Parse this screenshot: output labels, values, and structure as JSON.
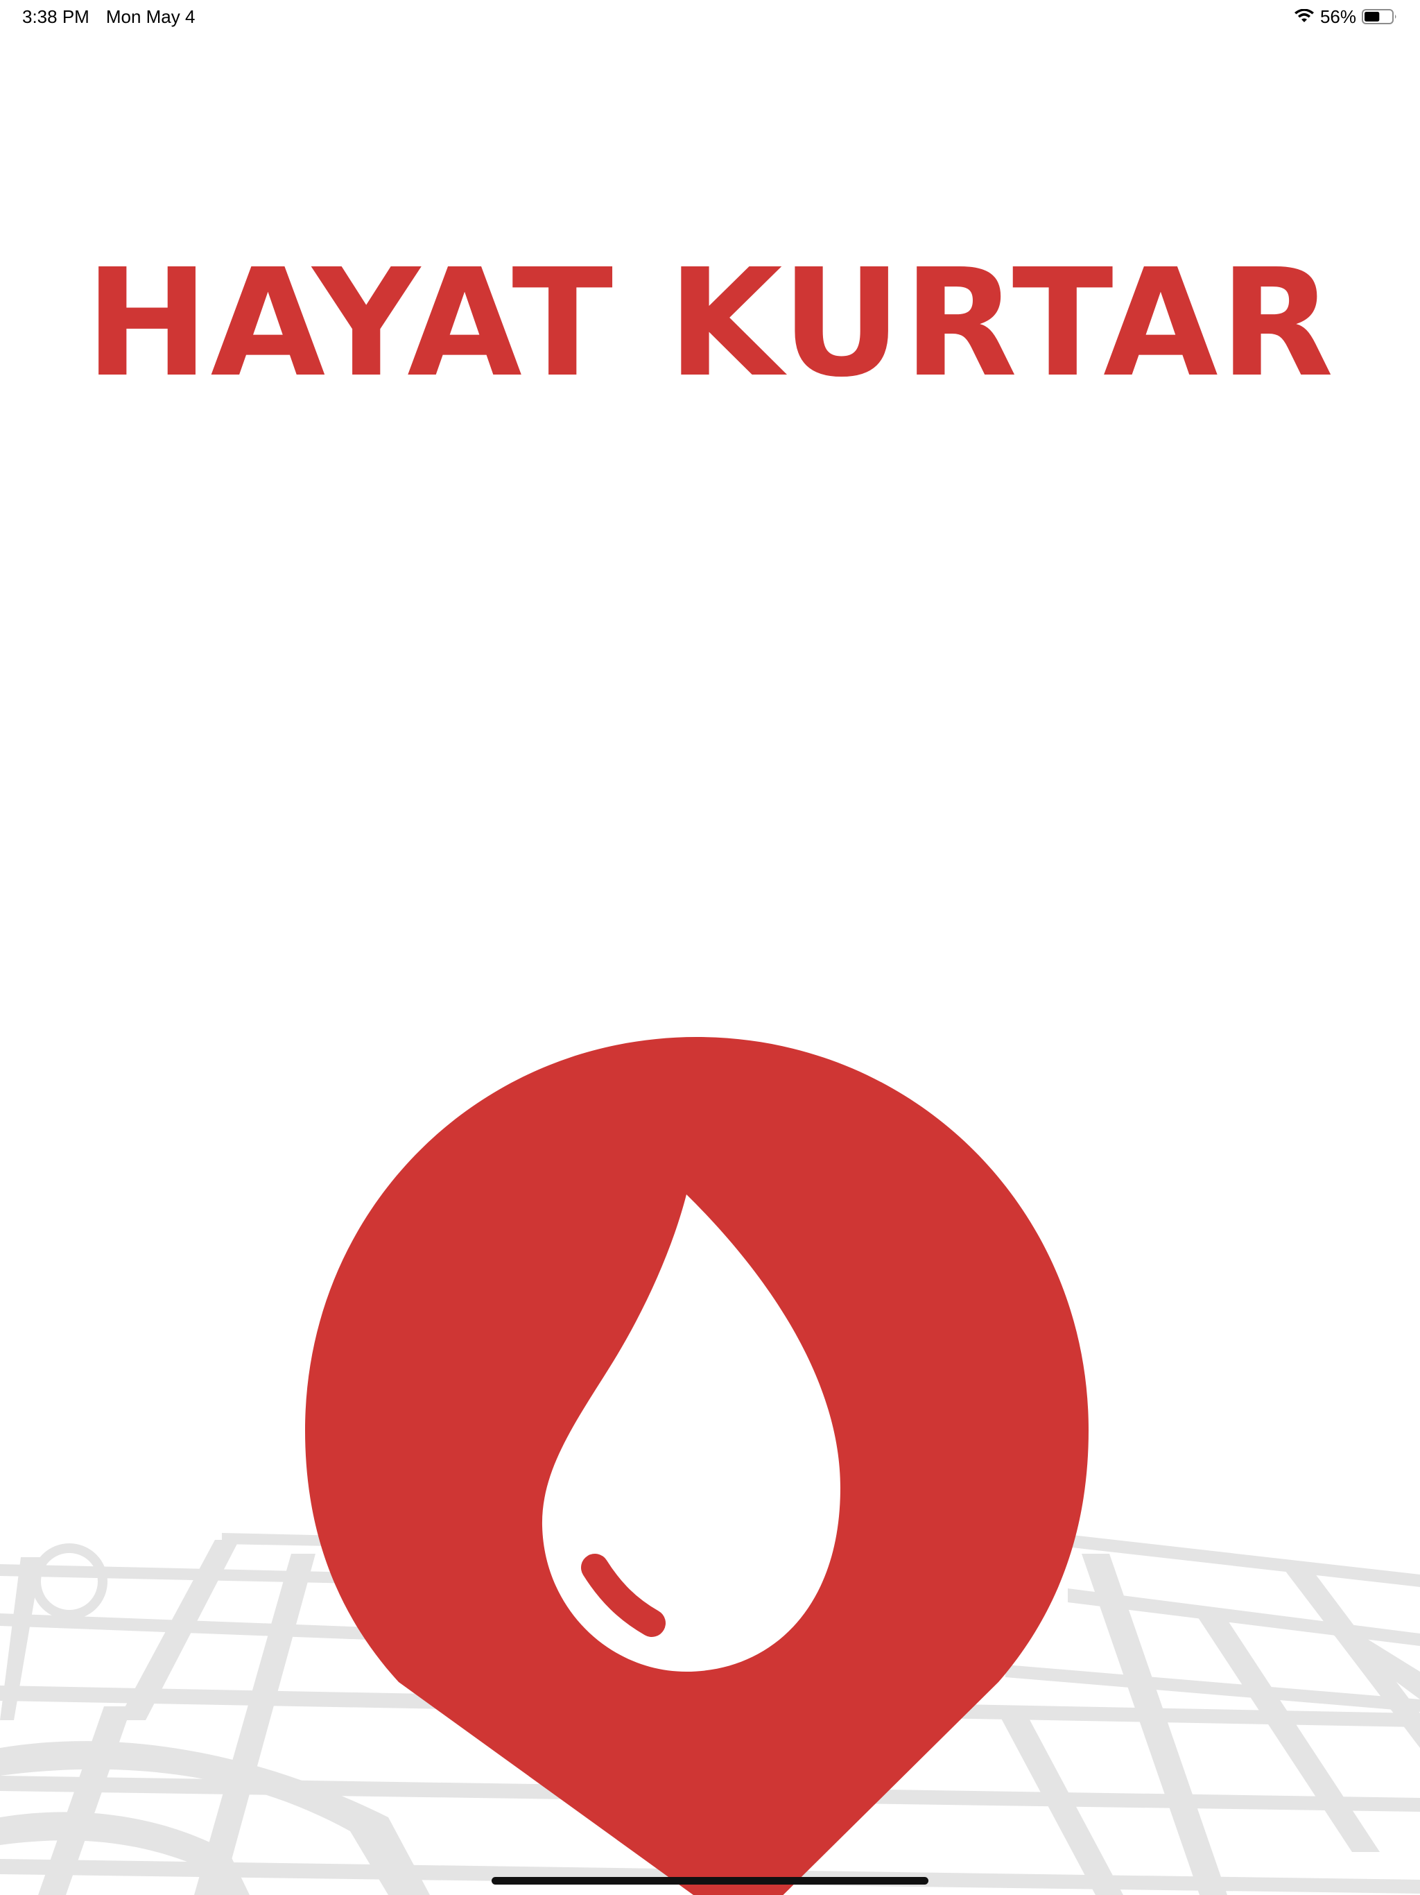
{
  "status_bar": {
    "time": "3:38 PM",
    "date": "Mon May 4",
    "battery_percent": "56%",
    "battery_level": 0.56
  },
  "app": {
    "title": "HAYAT KURTAR"
  },
  "colors": {
    "brand_red": "#cf3634",
    "map_gray": "#e4e4e4",
    "background": "#ffffff"
  },
  "icons": {
    "logo": "blood-drop-location-pin-icon",
    "background": "street-map-pattern"
  }
}
